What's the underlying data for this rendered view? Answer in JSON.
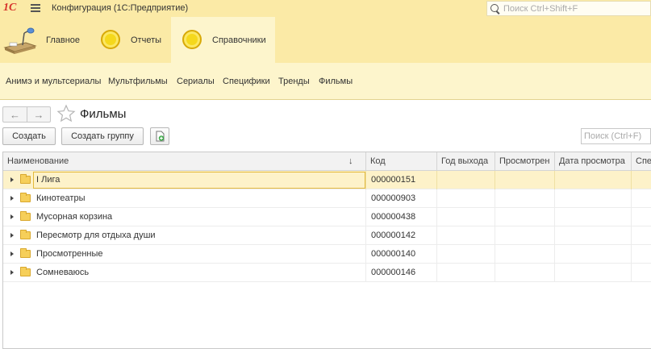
{
  "titlebar": {
    "logo": "1С",
    "title": "Конфигурация  (1С:Предприятие)",
    "search_placeholder": "Поиск Ctrl+Shift+F"
  },
  "sections": [
    {
      "label": "Главное",
      "icon": "desk-lamp-icon"
    },
    {
      "label": "Отчеты",
      "icon": "coin-icon"
    },
    {
      "label": "Справочники",
      "icon": "coin-icon",
      "active": true
    }
  ],
  "subsections": [
    "Анимэ и мультсериалы",
    "Мультфильмы",
    "Сериалы",
    "Специфики",
    "Тренды",
    "Фильмы"
  ],
  "form": {
    "back_icon": "←",
    "forward_icon": "→",
    "title": "Фильмы"
  },
  "commands": {
    "create": "Создать",
    "create_group": "Создать группу",
    "search_placeholder": "Поиск (Ctrl+F)"
  },
  "table": {
    "columns": [
      "Наименование",
      "Код",
      "Год выхода",
      "Просмотрен",
      "Дата просмотра",
      "Спе"
    ],
    "sort_indicator": "↓",
    "rows": [
      {
        "name": "I Лига",
        "code": "000000151"
      },
      {
        "name": "Кинотеатры",
        "code": "000000903"
      },
      {
        "name": "Мусорная корзина",
        "code": "000000438"
      },
      {
        "name": "Пересмотр для отдыха души",
        "code": "000000142"
      },
      {
        "name": "Просмотренные",
        "code": "000000140"
      },
      {
        "name": "Сомневаюсь",
        "code": "000000146"
      }
    ]
  },
  "colors": {
    "panel": "#fbeaa6",
    "panel_light": "#fdf5cc",
    "selection": "#fdf2c9",
    "logo_red": "#d6332b"
  }
}
